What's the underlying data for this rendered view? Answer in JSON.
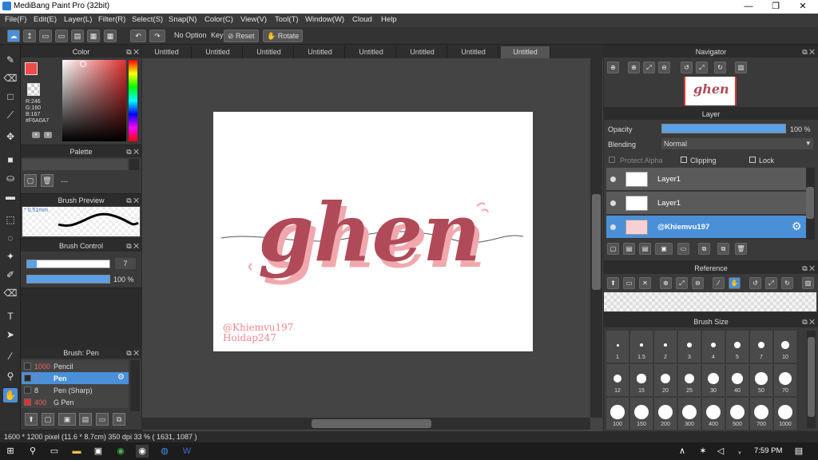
{
  "window": {
    "title": "MediBang Paint Pro (32bit)",
    "min": "—",
    "restore": "❐",
    "close": "✕"
  },
  "menu": [
    "File(F)",
    "Edit(E)",
    "Layer(L)",
    "Filter(R)",
    "Select(S)",
    "Snap(N)",
    "Color(C)",
    "View(V)",
    "Tool(T)",
    "Window(W)",
    "Cloud",
    "Help"
  ],
  "toolbar": {
    "no_option": "No Option",
    "key": "Key",
    "reset": "Reset",
    "rotate": "Rotate"
  },
  "tabs": [
    "Untitled",
    "Untitled",
    "Untitled",
    "Untitled",
    "Untitled",
    "Untitled",
    "Untitled",
    "Untitled"
  ],
  "active_tab_index": 7,
  "color_panel": {
    "title": "Color",
    "r": "R:246",
    "g": "G:160",
    "b": "B:167",
    "hex": "#F6A0A7",
    "fg": "#f04a4a"
  },
  "palette_panel": {
    "title": "Palette",
    "placeholder": "---"
  },
  "brush_preview": {
    "title": "Brush Preview",
    "size": "0.51mm"
  },
  "brush_control": {
    "title": "Brush Control",
    "size_value": "7",
    "opacity_value": "100 %",
    "opacity_level": 1.0
  },
  "brush_list": {
    "title": "Brush: Pen",
    "items": [
      {
        "size": "1000",
        "name": "Pencil",
        "selected": false,
        "color": "#333333"
      },
      {
        "size": "7",
        "name": "Pen",
        "selected": true,
        "color": "#2a2a2a"
      },
      {
        "size": "8",
        "name": "Pen (Sharp)",
        "selected": false,
        "color": "#333333"
      },
      {
        "size": "400",
        "name": "G Pen",
        "selected": false,
        "color": "#e03030"
      }
    ]
  },
  "canvas": {
    "text": "ghen",
    "signature1": "@Khiemvu197",
    "signature2": "Hoidap247",
    "lettering_color": "#b04a58",
    "outline_color": "#f0a8ae"
  },
  "navigator": {
    "title": "Navigator"
  },
  "layer_panel": {
    "title": "Layer",
    "opacity_label": "Opacity",
    "opacity_value": "100 %",
    "opacity_level": 1.0,
    "blending_label": "Blending",
    "blending_value": "Normal",
    "protect_alpha": "Protect Alpha",
    "clipping": "Clipping",
    "lock": "Lock",
    "layers": [
      {
        "name": "Layer1",
        "selected": false
      },
      {
        "name": "Layer1",
        "selected": false
      },
      {
        "name": "@Khiemvu197",
        "selected": true
      }
    ]
  },
  "reference": {
    "title": "Reference"
  },
  "brush_size": {
    "title": "Brush Size",
    "sizes": [
      "1",
      "1.5",
      "2",
      "3",
      "4",
      "5",
      "7",
      "10",
      "12",
      "15",
      "20",
      "25",
      "30",
      "40",
      "50",
      "70",
      "100",
      "150",
      "200",
      "300",
      "400",
      "500",
      "700",
      "1000"
    ]
  },
  "status": {
    "text": "1600 * 1200 pixel  (11.6 * 8.7cm)  350 dpi  33 %  ( 1631, 1087 )"
  },
  "taskbar": {
    "time": "7:59 PM"
  }
}
